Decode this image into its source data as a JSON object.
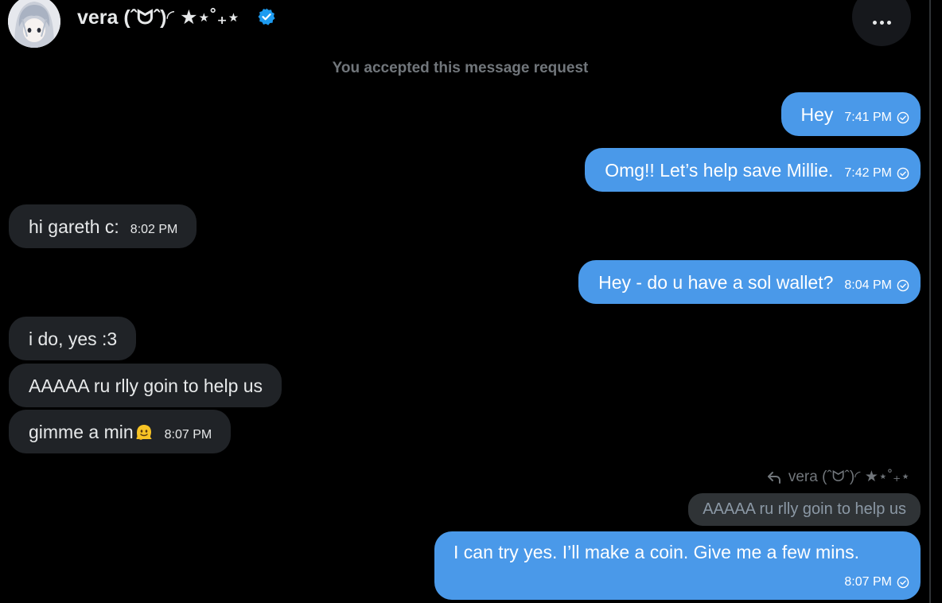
{
  "header": {
    "display_name": "vera (ˆᗢˆ)◜ ★⋆˚₊⋆",
    "verified": true,
    "avatar_icon": "avatar-image",
    "more_icon": "more-dots-icon"
  },
  "system_note": "You accepted this message request",
  "messages": [
    {
      "direction": "out",
      "text": "Hey",
      "time": "7:41 PM",
      "status_icon": "read-check-icon"
    },
    {
      "direction": "out",
      "text": "Omg!! Let’s help save Millie.",
      "time": "7:42 PM",
      "status_icon": "read-check-icon"
    },
    {
      "direction": "in",
      "text": "hi gareth c:",
      "time": "8:02 PM"
    },
    {
      "direction": "out",
      "text": "Hey - do u have a sol wallet?",
      "time": "8:04 PM",
      "status_icon": "read-check-icon"
    },
    {
      "direction": "in",
      "text": "i do, yes :3",
      "time": ""
    },
    {
      "direction": "in",
      "text": "AAAAA ru rlly goin to help us",
      "time": ""
    },
    {
      "direction": "in",
      "text": "gimme a min",
      "emoji": "melting-face-icon",
      "time": "8:07 PM"
    }
  ],
  "reply": {
    "reply_icon": "reply-arrow-icon",
    "replying_to": "vera (ˆᗢˆ)◜ ★⋆˚₊⋆",
    "quoted_text": "AAAAA ru rlly goin to help us",
    "text": "I can try yes. I’ll make a coin. Give me a few mins.",
    "time": "8:07 PM",
    "status_icon": "read-check-icon"
  },
  "colors": {
    "background": "#000000",
    "outgoing_bubble": "#4a99e9",
    "incoming_bubble": "#202327",
    "muted_text": "#71767b",
    "verified_badge": "#1d9bf0"
  }
}
